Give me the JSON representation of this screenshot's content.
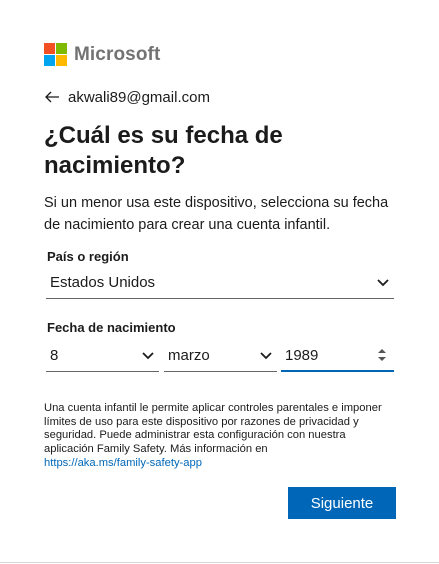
{
  "colors": {
    "accent": "#0067b8",
    "logo_red": "#f25022",
    "logo_green": "#7fba00",
    "logo_blue": "#00a4ef",
    "logo_yellow": "#ffb900"
  },
  "logo": {
    "wordmark": "Microsoft"
  },
  "identity": {
    "icon": "back-arrow-icon",
    "email": "akwali89@gmail.com"
  },
  "title": "¿Cuál es su fecha de nacimiento?",
  "description": "Si un menor usa este dispositivo, selecciona su fecha de nacimiento para crear una cuenta infantil.",
  "country": {
    "label": "País o región",
    "value": "Estados Unidos"
  },
  "birthdate": {
    "label": "Fecha de nacimiento",
    "day": "8",
    "month": "marzo",
    "year": "1989"
  },
  "note": {
    "text": "Una cuenta infantil le permite aplicar controles parentales e imponer límites de uso para este dispositivo por razones de privacidad y seguridad. Puede administrar esta configuración con nuestra aplicación Family Safety. Más información en",
    "link": "https://aka.ms/family-safety-app"
  },
  "next_button": {
    "label": "Siguiente"
  }
}
